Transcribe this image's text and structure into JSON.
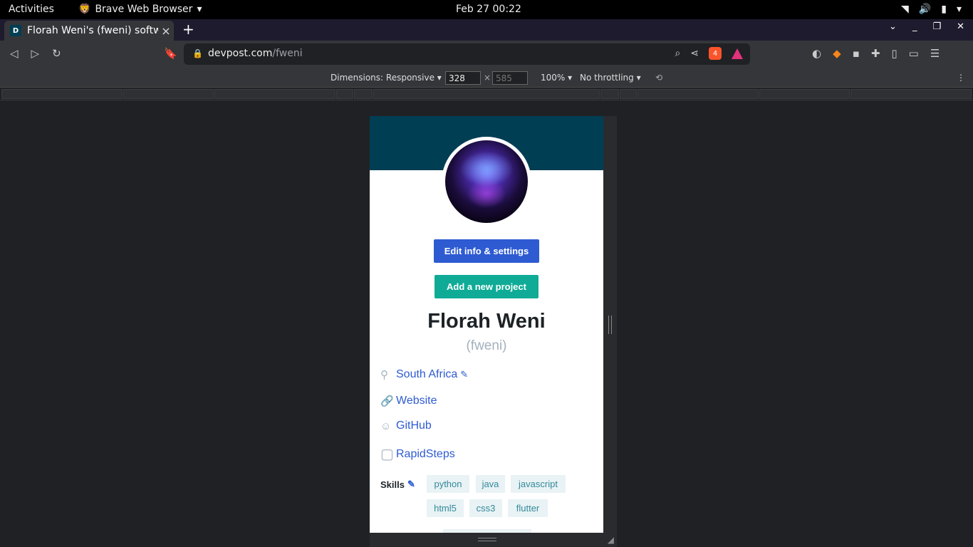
{
  "system": {
    "activities": "Activities",
    "app_name": "Brave Web Browser",
    "clock": "Feb 27  00:22"
  },
  "tab": {
    "favicon_letter": "D",
    "title": "Florah Weni's (fweni) softw",
    "close": "×",
    "new_tab": "+"
  },
  "address": {
    "domain": "devpost.com",
    "path": "/fweni",
    "shield_count": "4"
  },
  "devtools": {
    "dimensions_label": "Dimensions: Responsive",
    "width": "328",
    "height": "585",
    "times": "×",
    "zoom": "100%",
    "throttling": "No throttling"
  },
  "profile": {
    "edit_button": "Edit info & settings",
    "add_button": "Add a new project",
    "name": "Florah Weni",
    "handle": "(fweni)",
    "location": "South Africa",
    "website": "Website",
    "github": "GitHub",
    "clipboard_link": "RapidSteps",
    "skills_label": "Skills",
    "skills": [
      "python",
      "java",
      "javascript",
      "html5",
      "css3",
      "flutter"
    ]
  },
  "colors": {
    "banner": "#003e54",
    "edit_button": "#2e5bd2",
    "add_button": "#0fab96",
    "link": "#2e5bd2",
    "tag_bg": "#e9f2f4",
    "tag_text": "#338b9c"
  }
}
